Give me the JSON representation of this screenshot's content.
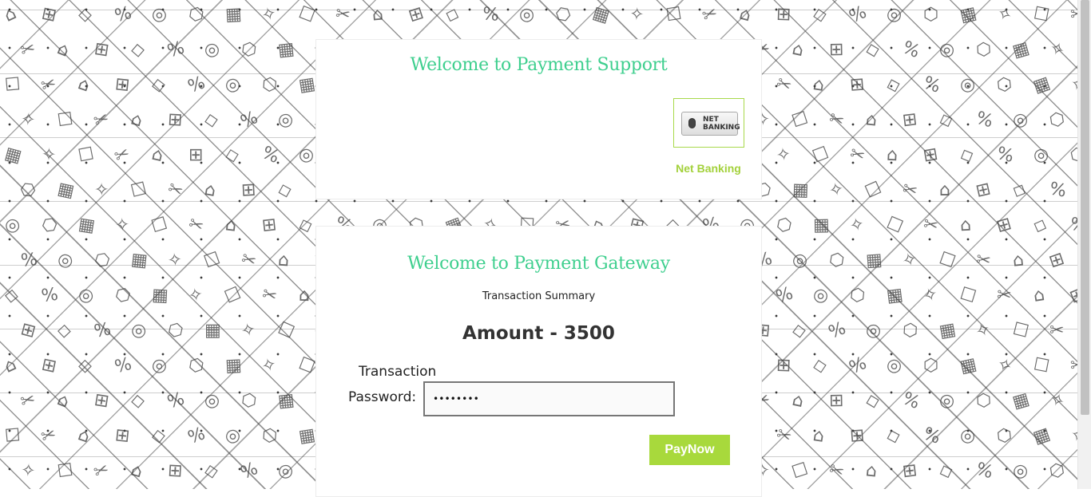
{
  "support_card": {
    "title": "Welcome to Payment Support",
    "option": {
      "icon": "net-banking-icon",
      "icon_text_line1": "NET",
      "icon_text_line2": "BANKING",
      "label": "Net Banking"
    }
  },
  "gateway_card": {
    "title": "Welcome to Payment Gateway",
    "summary": "Transaction Summary",
    "amount": "Amount - 3500",
    "password_label_line1": "Transaction",
    "password_label_line2": "Password:",
    "password_value": "••••••••",
    "pay_button": "PayNow"
  },
  "colors": {
    "heading": "#3ecf8e",
    "accent": "#a8d93c",
    "net_banking_label": "#a3d13b"
  },
  "background_icons": [
    "piggy-bank-icon",
    "shopping-basket-icon",
    "hanger-icon",
    "percent-badge-icon",
    "gift-icon",
    "shopping-bag-icon",
    "cart-icon",
    "barcode-icon",
    "price-tag-icon",
    "coupon-icon",
    "scissors-icon",
    "bread-icon"
  ]
}
